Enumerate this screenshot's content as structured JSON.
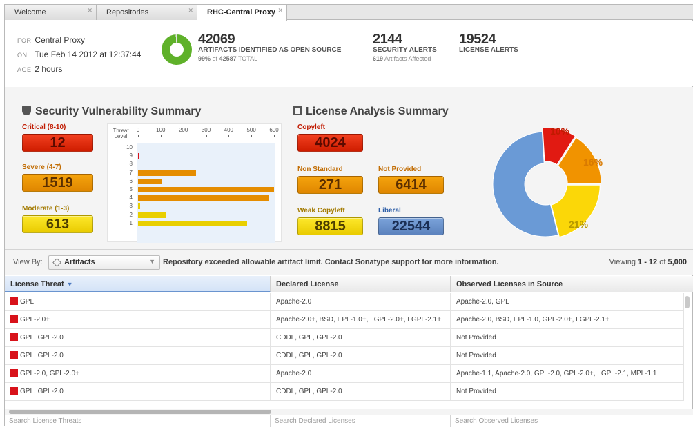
{
  "tabs": [
    {
      "label": "Welcome"
    },
    {
      "label": "Repositories"
    },
    {
      "label": "RHC-Central Proxy"
    }
  ],
  "tab_close_glyph": "✕",
  "summary": {
    "for_key": "FOR",
    "for_val": "Central Proxy",
    "on_key": "ON",
    "on_val": "Tue Feb 14 2012 at 12:37:44",
    "age_key": "AGE",
    "age_val": "2 hours",
    "artifacts": {
      "count": "42069",
      "label": "ARTIFACTS IDENTIFIED AS OPEN SOURCE",
      "pct": "99%",
      "of": "of",
      "total": "42587",
      "total_label": "TOTAL",
      "fraction": 0.988
    },
    "security": {
      "count": "2144",
      "label": "SECURITY ALERTS",
      "affected": "619",
      "affected_label": "Artifacts Affected"
    },
    "license": {
      "count": "19524",
      "label": "LICENSE ALERTS"
    }
  },
  "security_summary": {
    "title": "Security Vulnerability Summary",
    "critical_label": "Critical (8-10)",
    "critical_value": "12",
    "severe_label": "Severe (4-7)",
    "severe_value": "1519",
    "moderate_label": "Moderate (1-3)",
    "moderate_value": "613",
    "axis_title": "Threat Level"
  },
  "license_summary": {
    "title": "License Analysis Summary",
    "copyleft_label": "Copyleft",
    "copyleft_value": "4024",
    "nonstandard_label": "Non Standard",
    "nonstandard_value": "271",
    "notprovided_label": "Not Provided",
    "notprovided_value": "6414",
    "weak_label": "Weak Copyleft",
    "weak_value": "8815",
    "liberal_label": "Liberal",
    "liberal_value": "22544"
  },
  "chart_data": [
    {
      "type": "bar",
      "orientation": "horizontal",
      "ylabel": "Threat Level",
      "categories": [
        "10",
        "9",
        "8",
        "7",
        "6",
        "5",
        "4",
        "3",
        "2",
        "1"
      ],
      "values": [
        0,
        6,
        0,
        255,
        105,
        600,
        580,
        8,
        125,
        480
      ],
      "colors": [
        "#d8121a",
        "#d8121a",
        "#d8121a",
        "#e58d00",
        "#e58d00",
        "#e58d00",
        "#e58d00",
        "#e9cf00",
        "#e9cf00",
        "#e9cf00"
      ],
      "xticks": [
        "0",
        "100",
        "200",
        "300",
        "400",
        "500",
        "600"
      ],
      "xlim": [
        0,
        600
      ],
      "grid": false
    },
    {
      "type": "pie",
      "labels": [
        "10%",
        "16%",
        "21%"
      ],
      "values": [
        0.1,
        0.16,
        0.21,
        0.53
      ],
      "colors": [
        "#e11a12",
        "#f19300",
        "#fbd708",
        "#6a9ad6"
      ]
    }
  ],
  "toolbar": {
    "view_by_label": "View By:",
    "view_by_value": "Artifacts",
    "message": "Repository exceeded allowable artifact limit. Contact Sonatype support for more information.",
    "viewing_prefix": "Viewing",
    "viewing_range": "1 - 12",
    "viewing_of": "of",
    "viewing_total": "5,000"
  },
  "table": {
    "headers": [
      "License Threat",
      "Declared License",
      "Observed Licenses in Source"
    ],
    "threat_color": "#d8121a",
    "rows": [
      [
        "GPL",
        "Apache-2.0",
        "Apache-2.0, GPL"
      ],
      [
        "GPL-2.0+",
        "Apache-2.0+, BSD, EPL-1.0+, LGPL-2.0+, LGPL-2.1+",
        "Apache-2.0, BSD, EPL-1.0, GPL-2.0+, LGPL-2.1+"
      ],
      [
        "GPL, GPL-2.0",
        "CDDL, GPL, GPL-2.0",
        "Not Provided"
      ],
      [
        "GPL, GPL-2.0",
        "CDDL, GPL, GPL-2.0",
        "Not Provided"
      ],
      [
        "GPL-2.0, GPL-2.0+",
        "Apache-2.0",
        "Apache-1.1, Apache-2.0, GPL-2.0, GPL-2.0+, LGPL-2.1, MPL-1.1"
      ],
      [
        "GPL, GPL-2.0",
        "CDDL, GPL, GPL-2.0",
        "Not Provided"
      ]
    ],
    "filters": [
      "Search License Threats",
      "Search Declared Licenses",
      "Search Observed Licenses"
    ]
  }
}
